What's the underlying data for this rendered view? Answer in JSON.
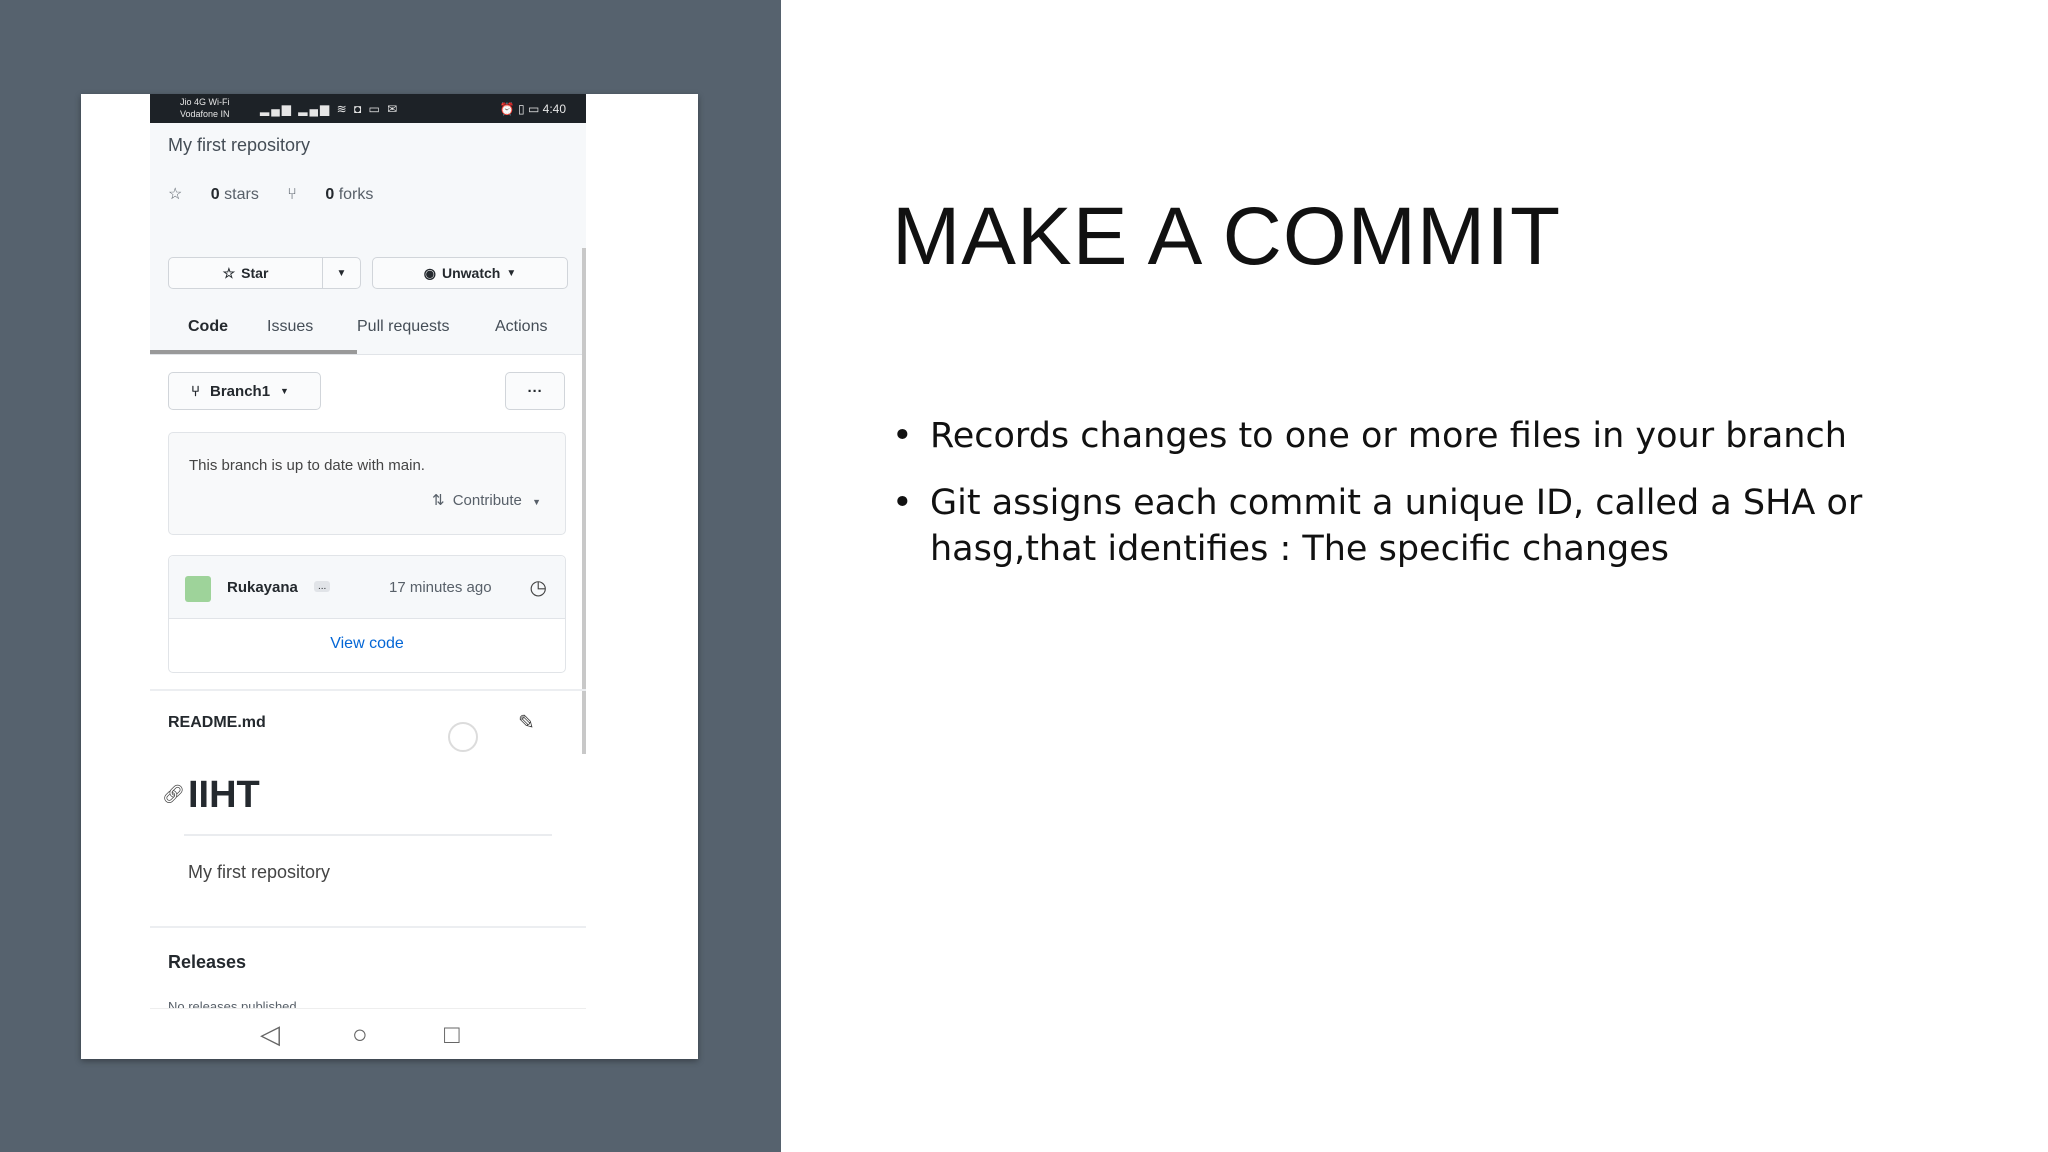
{
  "slide": {
    "title": "MAKE A COMMIT",
    "bullets": [
      "Records changes to one  or more files in your branch",
      "Git assigns each commit a unique ID, called a SHA or hasg,that identifies : The specific changes"
    ]
  },
  "phone": {
    "statusbar": {
      "carrier_line1": "Jio 4G Wi-Fi",
      "carrier_line2": "Vodafone IN",
      "icons": "▂▄▆ ▂▄▆ ≋ ◘ ▭ ✉",
      "right_icons": "⏰ ▯ ▭",
      "time": "4:40"
    },
    "repo": {
      "description": "My first repository",
      "stars_count": "0",
      "stars_label": "stars",
      "forks_count": "0",
      "forks_label": "forks",
      "star_button": "Star",
      "unwatch_button": "Unwatch"
    },
    "tabs": [
      "Code",
      "Issues",
      "Pull requests",
      "Actions"
    ],
    "branch": {
      "name": "Branch1",
      "status": "This branch is up to date with main.",
      "contribute": "Contribute"
    },
    "commit": {
      "author": "Rukayana",
      "badge": "...",
      "time": "17 minutes ago",
      "view_code": "View code"
    },
    "readme": {
      "filename": "README.md",
      "heading": "IIHT",
      "body": "My first repository"
    },
    "releases": {
      "title": "Releases",
      "subtitle": "No releases published"
    }
  }
}
